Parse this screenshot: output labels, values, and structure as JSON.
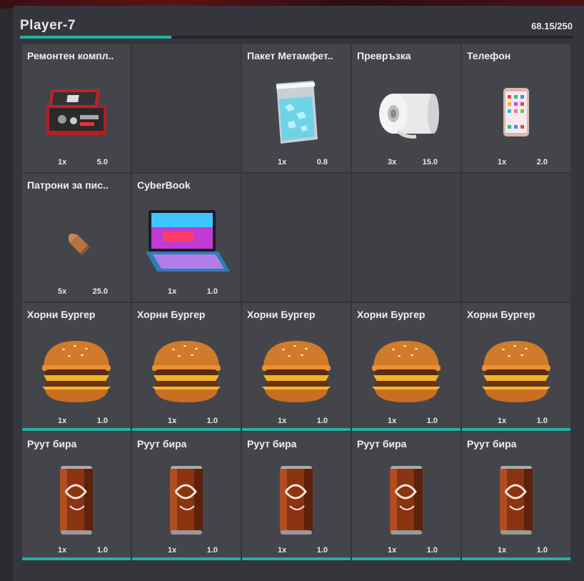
{
  "inventory": {
    "title": "Player-7",
    "weight_text": "68.15/250",
    "weight_fraction": 0.2726
  },
  "slots": [
    {
      "name": "Ремонтен компл..",
      "qty": "1x",
      "weight": "5.0",
      "icon": "repair-kit-icon",
      "hotbar": false
    },
    {
      "name": "",
      "qty": "",
      "weight": "",
      "icon": "",
      "hotbar": false
    },
    {
      "name": "Пакет Метамфет..",
      "qty": "1x",
      "weight": "0.8",
      "icon": "meth-bag-icon",
      "hotbar": false
    },
    {
      "name": "Превръзка",
      "qty": "3x",
      "weight": "15.0",
      "icon": "bandage-icon",
      "hotbar": false
    },
    {
      "name": "Телефон",
      "qty": "1x",
      "weight": "2.0",
      "icon": "phone-icon",
      "hotbar": false
    },
    {
      "name": "Патрони за пис..",
      "qty": "5x",
      "weight": "25.0",
      "icon": "pistol-ammo-icon",
      "hotbar": false
    },
    {
      "name": "CyberBook",
      "qty": "1x",
      "weight": "1.0",
      "icon": "laptop-icon",
      "hotbar": false
    },
    {
      "name": "",
      "qty": "",
      "weight": "",
      "icon": "",
      "hotbar": false
    },
    {
      "name": "",
      "qty": "",
      "weight": "",
      "icon": "",
      "hotbar": false
    },
    {
      "name": "",
      "qty": "",
      "weight": "",
      "icon": "",
      "hotbar": false
    },
    {
      "name": "Хорни Бургер",
      "qty": "1x",
      "weight": "1.0",
      "icon": "burger-icon",
      "hotbar": true
    },
    {
      "name": "Хорни Бургер",
      "qty": "1x",
      "weight": "1.0",
      "icon": "burger-icon",
      "hotbar": true
    },
    {
      "name": "Хорни Бургер",
      "qty": "1x",
      "weight": "1.0",
      "icon": "burger-icon",
      "hotbar": true
    },
    {
      "name": "Хорни Бургер",
      "qty": "1x",
      "weight": "1.0",
      "icon": "burger-icon",
      "hotbar": true
    },
    {
      "name": "Хорни Бургер",
      "qty": "1x",
      "weight": "1.0",
      "icon": "burger-icon",
      "hotbar": true
    },
    {
      "name": "Руут бира",
      "qty": "1x",
      "weight": "1.0",
      "icon": "root-beer-can-icon",
      "hotbar": true
    },
    {
      "name": "Руут бира",
      "qty": "1x",
      "weight": "1.0",
      "icon": "root-beer-can-icon",
      "hotbar": true
    },
    {
      "name": "Руут бира",
      "qty": "1x",
      "weight": "1.0",
      "icon": "root-beer-can-icon",
      "hotbar": true
    },
    {
      "name": "Руут бира",
      "qty": "1x",
      "weight": "1.0",
      "icon": "root-beer-can-icon",
      "hotbar": true
    },
    {
      "name": "Руут бира",
      "qty": "1x",
      "weight": "1.0",
      "icon": "root-beer-can-icon",
      "hotbar": true
    }
  ],
  "colors": {
    "accent": "#1fb3a4",
    "panel": "#35363c",
    "slot": "#44454b"
  }
}
